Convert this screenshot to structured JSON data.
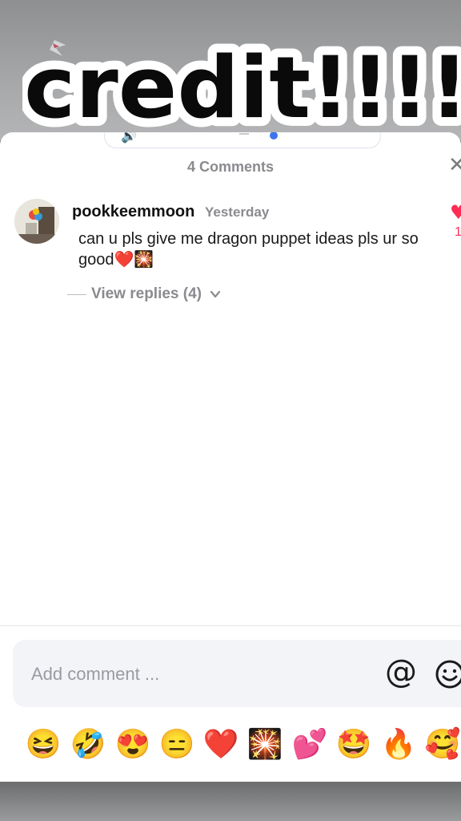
{
  "overlay": {
    "caption": "credit!!!!"
  },
  "header": {
    "comments_count": "4 Comments"
  },
  "comment": {
    "username": "pookkeemmoon",
    "timestamp": "Yesterday",
    "text": "can u pls give me dragon puppet ideas pls ur so good❤️🎇",
    "like_count": "1",
    "view_replies": "View replies (4)"
  },
  "input": {
    "placeholder": "Add comment ..."
  },
  "quick_emojis": [
    "😆",
    "🤣",
    "😍",
    "😑",
    "❤️",
    "🎇",
    "💕",
    "🤩",
    "🔥",
    "🥰"
  ],
  "colors": {
    "accent": "#ff2d55",
    "player_blue": "#3d74f0"
  },
  "icons": [
    "speaker-icon",
    "close-icon",
    "heart-icon",
    "chevron-down-icon",
    "at-icon",
    "emoji-icon"
  ]
}
